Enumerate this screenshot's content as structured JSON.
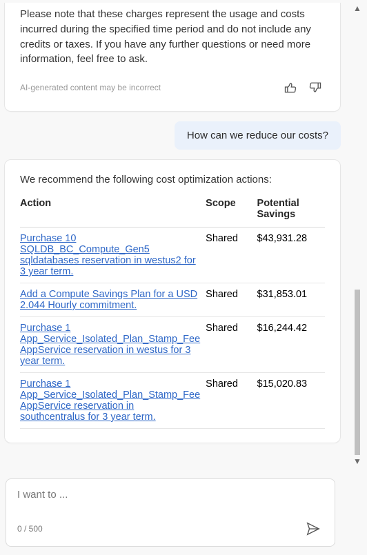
{
  "assistant_note": "Please note that these charges represent the usage and costs incurred during the specified time period and do not include any credits or taxes. If you have any further questions or need more information, feel free to ask.",
  "disclaimer": "AI-generated content may be incorrect",
  "user_message": "How can we reduce our costs?",
  "recommendation_intro": "We recommend the following cost optimization actions:",
  "table": {
    "headers": {
      "action": "Action",
      "scope": "Scope",
      "savings": "Potential Savings"
    },
    "rows": [
      {
        "action": "Purchase 10 SQLDB_BC_Compute_Gen5 sqldatabases reservation in westus2 for 3 year term.",
        "scope": "Shared",
        "savings": "$43,931.28"
      },
      {
        "action": "Add a Compute Savings Plan for a USD 2.044 Hourly commitment.",
        "scope": "Shared",
        "savings": "$31,853.01"
      },
      {
        "action": "Purchase 1 App_Service_Isolated_Plan_Stamp_Fee AppService reservation in westus for 3 year term.",
        "scope": "Shared",
        "savings": "$16,244.42"
      },
      {
        "action": "Purchase 1 App_Service_Isolated_Plan_Stamp_Fee AppService reservation in southcentralus for 3 year term.",
        "scope": "Shared",
        "savings": "$15,020.83"
      }
    ]
  },
  "composer": {
    "placeholder": "I want to ...",
    "char_count": "0 / 500"
  }
}
